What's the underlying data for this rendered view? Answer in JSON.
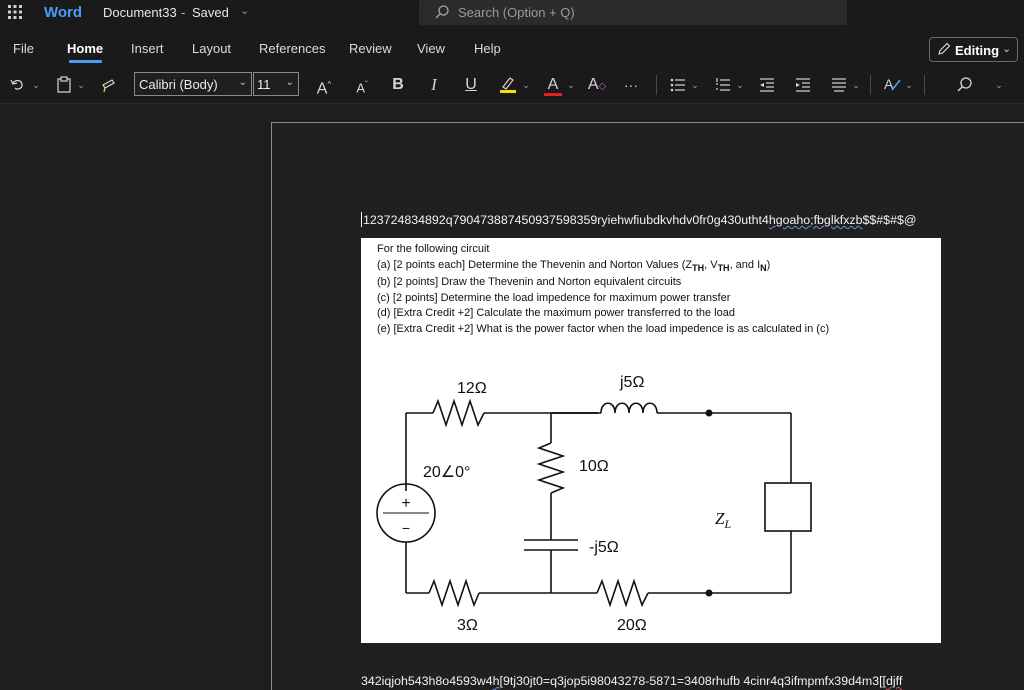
{
  "titlebar": {
    "app_name": "Word",
    "doc_name": "Document33",
    "separator": "-",
    "doc_status": "Saved",
    "search_placeholder": "Search (Option + Q)"
  },
  "tabs": [
    "File",
    "Home",
    "Insert",
    "Layout",
    "References",
    "Review",
    "View",
    "Help"
  ],
  "active_tab": "Home",
  "editing_mode": "Editing",
  "toolbar": {
    "font_name": "Calibri (Body)",
    "font_size": "11",
    "grow_font": "A",
    "shrink_font": "A",
    "bold": "B",
    "italic": "I",
    "underline": "U",
    "font_color_letter": "A",
    "clear_format_letter": "A",
    "more": "···",
    "highlight_color": "#f5e100",
    "font_color": "#e02020"
  },
  "document": {
    "line1": "123724834892q79047388745093759835 9ryiehwfiubdkvhdv0fr0g430utht4",
    "line1_a": "123724834892q79047388745093759835 9ryiehwfiubdkvhdv0fr0g430utht4",
    "line1_main": "123724834892q790473887450937598359ryiehwfiubdkvhdv0fr0g430utht4",
    "line1_squiggle": "hgoaho;fbglkfxzb",
    "line1_tail": "$$#$#$@",
    "question_lines": [
      "For the following circuit",
      "(a) [2 points each] Determine the Thevenin and Norton Values (Z",
      "(b) [2 points] Draw the Thevenin and Norton equivalent circuits",
      "(c) [2 points] Determine the load impedence for maximum power transfer",
      "(d) [Extra Credit +2] Calculate the maximum power transferred to the load",
      "(e) [Extra Credit +2] What is the power factor when the load impedence is as calculated in (c)"
    ],
    "q_a_parts": {
      "zth_sub": "TH",
      "sep1": ", V",
      "vth_sub": "TH",
      "sep2": ", and I",
      "in_sub": "N",
      "close": ")"
    },
    "circuit_labels": {
      "r12": "12Ω",
      "l5": "j5Ω",
      "source": "20∠0°",
      "r10": "10Ω",
      "c5": "-j5Ω",
      "zl": "Z",
      "zl_sub": "L",
      "r3": "3Ω",
      "r20": "20Ω",
      "plus": "+",
      "minus": "−"
    },
    "line2_main": "342iqjoh543h8o4593w4",
    "line2_squiggle": "h",
    "line2_rest": "[9tj30jt0=q3jop5i98043278-5871=3408rhufb 4cinr4q3ifmpmfx39d4m3[[",
    "line2_end": "djff"
  }
}
